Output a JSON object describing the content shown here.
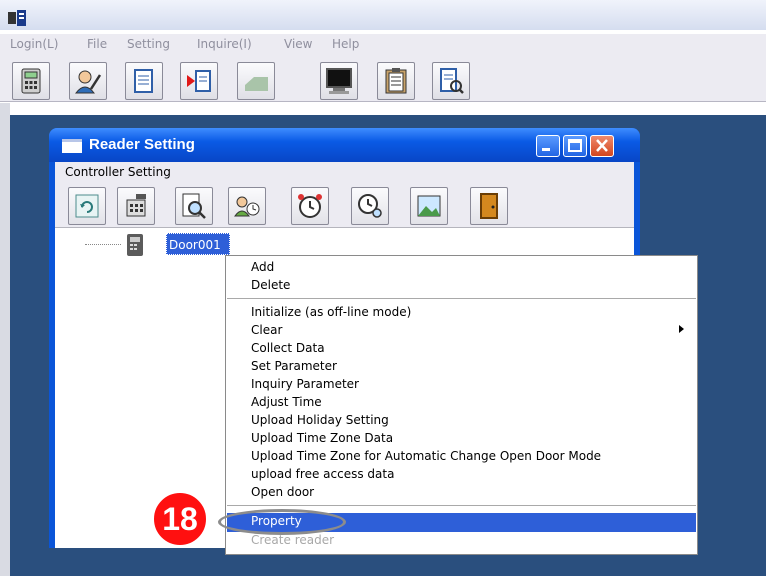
{
  "app": {
    "menu": [
      "Login(L)",
      "File",
      "Setting",
      "Inquire(I)",
      "View",
      "Help"
    ],
    "toolbar_icons": [
      "calculator-icon",
      "user-edit-icon",
      "document-icon",
      "play-document-icon",
      "eraser-icon",
      "monitor-icon",
      "clipboard-icon",
      "search-document-icon"
    ]
  },
  "child_window": {
    "title": "Reader Setting",
    "menu_label": "Controller Setting",
    "toolbar_icons": [
      "refresh-icon",
      "controller-icon",
      "search-page-icon",
      "user-clock-icon",
      "alarm-clock-icon",
      "clock-search-icon",
      "picture-icon",
      "exit-door-icon"
    ],
    "tree_item": "Door001"
  },
  "context_menu": {
    "group1": [
      "Add",
      "Delete"
    ],
    "group2": [
      "Initialize (as off-line mode)",
      "Clear",
      "Collect Data",
      "Set Parameter",
      "Inquiry Parameter",
      "Adjust Time",
      "Upload Holiday Setting",
      "Upload Time Zone Data",
      "Upload Time Zone for  Automatic Change Open Door Mode",
      "upload free access data",
      "Open door"
    ],
    "group3": [
      "Property",
      "Create reader"
    ],
    "selected": "Property",
    "disabled": "Create reader"
  },
  "annotation": {
    "step_number": "18"
  },
  "colors": {
    "accent": "#2e5fd8",
    "title_bar": "#0a55d8",
    "desktop": "#2a4f7e",
    "annotation": "#ff1010"
  }
}
